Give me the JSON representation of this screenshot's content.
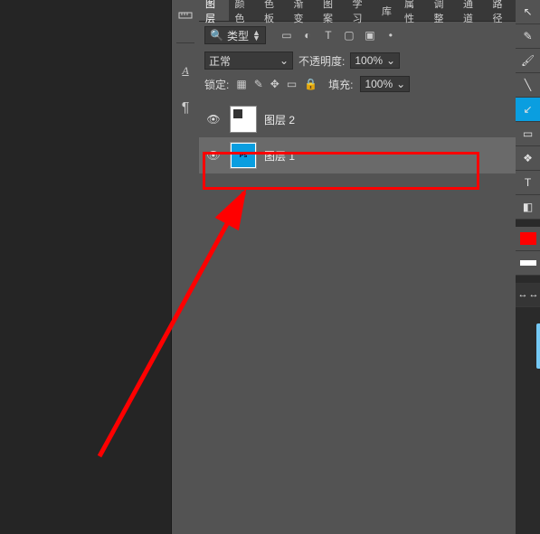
{
  "midtools": {
    "a": "A",
    "pil": "¶"
  },
  "tabs": [
    "图层",
    "颜色",
    "色板",
    "渐变",
    "图案",
    "学习",
    "库",
    "属性",
    "调整",
    "通道",
    "路径"
  ],
  "active_tab": 0,
  "filter": {
    "label": "类型",
    "icons": [
      "▭",
      "◐",
      "T",
      "▢",
      "▣",
      "•"
    ]
  },
  "row2": {
    "mode": "正常",
    "opacity_label": "不透明度:",
    "opacity": "100%"
  },
  "row3": {
    "lock_label": "锁定:",
    "fill_label": "填充:",
    "fill": "100%",
    "lock_icons": [
      "▦",
      "✎",
      "✥",
      "▭",
      "🔒"
    ]
  },
  "layers": [
    {
      "name": "图层 2",
      "visible": true,
      "selected": false,
      "thumb": "chk"
    },
    {
      "name": "图层 1",
      "visible": true,
      "selected": true,
      "thumb": "ps"
    }
  ],
  "rtools": [
    {
      "t": "cursor",
      "g": "↖"
    },
    {
      "t": "pencil",
      "g": "✎"
    },
    {
      "t": "brush",
      "g": "🖌"
    },
    {
      "t": "line",
      "g": "╲"
    },
    {
      "t": "arrow",
      "g": "↙",
      "sel": true
    },
    {
      "t": "rect",
      "g": "▭"
    },
    {
      "t": "shapes",
      "g": "❖"
    },
    {
      "t": "text",
      "g": "T"
    },
    {
      "t": "eraser",
      "g": "◧"
    }
  ],
  "swatches": {
    "fg": "#ff0000",
    "bg": "#ffffff"
  },
  "flip": "↔ ↔"
}
